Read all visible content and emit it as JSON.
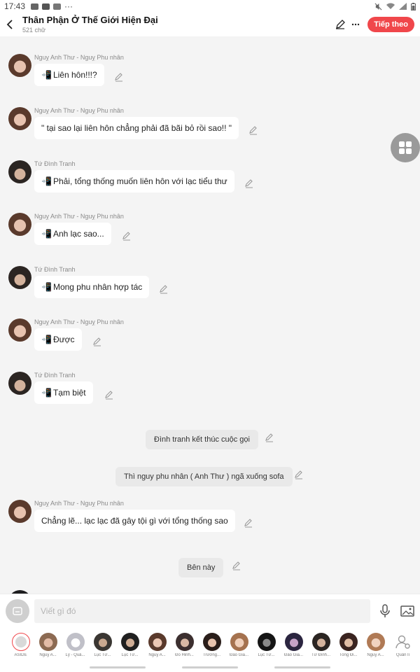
{
  "status": {
    "time": "17:43",
    "dots": "···"
  },
  "header": {
    "title": "Thân Phận Ở Thế Giới Hiện Đại",
    "word_count": "521 chữ",
    "next_label": "Tiếp theo"
  },
  "colors": {
    "accent": "#f0474b"
  },
  "messages": [
    {
      "speaker": "Nguỵ Anh Thư - Nguỵ Phu nhân",
      "text": "Liên hôn!!!?",
      "phone": true
    },
    {
      "speaker": "Nguỵ Anh Thư - Nguỵ Phu nhân",
      "text": "\" tại sao lại liên hôn chẳng phải đã bãi bỏ rồi sao!! \"",
      "phone": false
    },
    {
      "speaker": "Tứ Đình Tranh",
      "text": "Phải, tổng thống muốn liên hôn với lạc tiểu thư",
      "phone": true
    },
    {
      "speaker": "Nguỵ Anh Thư - Nguỵ Phu nhân",
      "text": "Anh lạc sao...",
      "phone": true
    },
    {
      "speaker": "Tứ Đình Tranh",
      "text": "Mong phu nhân hợp tác",
      "phone": true
    },
    {
      "speaker": "Nguỵ Anh Thư - Nguỵ Phu nhân",
      "text": "Được",
      "phone": true
    },
    {
      "speaker": "Tứ Đình Tranh",
      "text": "Tạm biệt",
      "phone": true
    },
    {
      "speaker": "Nguỵ Anh Thư - Nguỵ Phu nhân",
      "text": "Chẳng lẽ... lạc lạc đã gây tội gì với tổng thống sao",
      "phone": false
    }
  ],
  "narrations": [
    "Đình tranh kết thúc cuộc gọi",
    "Thì nguy phu nhân ( Anh Thư ) ngã xuống sofa",
    "Bên này"
  ],
  "input": {
    "placeholder": "Viết gì đó"
  },
  "characters": [
    "ASIDE",
    "Nguỵ A...",
    "Lý - Quả...",
    "Lục Tứ...",
    "Lục Tứ...",
    "Nguỵ A...",
    "Đỗ Hinh...",
    "Trương...",
    "Đào Gia...",
    "Lục Tứ...",
    "Đào Gia...",
    "Tứ Đình...",
    "Tống Đi...",
    "Nguỵ A...",
    "Quản lí"
  ]
}
